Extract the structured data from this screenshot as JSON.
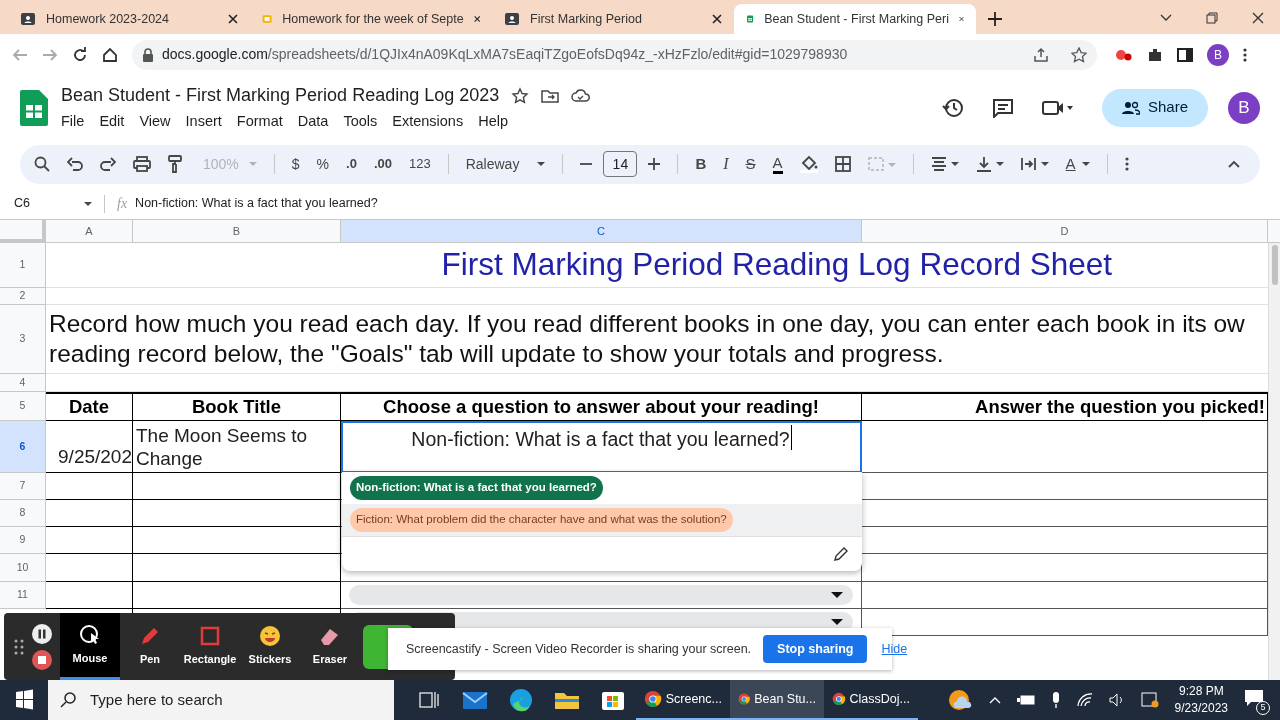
{
  "browser": {
    "tabs": [
      {
        "kind": "classroom",
        "title": "Homework 2023-2024",
        "selected": false
      },
      {
        "kind": "slides",
        "title": "Homework for the week of Septe",
        "selected": false
      },
      {
        "kind": "classroom",
        "title": "First Marking Period",
        "selected": false
      },
      {
        "kind": "sheets",
        "title": "Bean Student - First Marking Peri",
        "selected": true
      }
    ],
    "url_host": "docs.google.com",
    "url_path": "/spreadsheets/d/1QJIx4nA09KqLxMA7sEaqiTZgoEofsDq94z_-xHzFzlo/edit#gid=1029798930",
    "profile": "B"
  },
  "doc": {
    "title": "Bean Student - First Marking Period Reading Log 2023",
    "menu": [
      "File",
      "Edit",
      "View",
      "Insert",
      "Format",
      "Data",
      "Tools",
      "Extensions",
      "Help"
    ],
    "share": "Share",
    "avatar": "B"
  },
  "toolbar": {
    "zoom": "100%",
    "currency": "$",
    "percent": "%",
    "decrease_decimals": ".0",
    "increase_decimals": ".00",
    "number_format": "123",
    "font": "Raleway",
    "font_size": "14",
    "bold": "B",
    "italic": "I",
    "strikethrough": "S",
    "text_color": "A",
    "text_rotation": "A"
  },
  "formula_bar": {
    "cell": "C6",
    "fx_label": "fx",
    "formula": "Non-fiction: What is a fact that you learned?"
  },
  "sheet": {
    "columns": [
      {
        "label": "A",
        "selected": false
      },
      {
        "label": "B",
        "selected": false
      },
      {
        "label": "C",
        "selected": true
      },
      {
        "label": "D",
        "selected": false
      }
    ],
    "title": "First Marking Period Reading Log Record Sheet",
    "instructions": [
      "Record how much you read each day. If you read different books in one day, you can enter each book in its ow",
      "reading record below, the \"Goals\" tab will update to show your totals and progress."
    ],
    "headers": [
      "Date",
      "Book Title",
      "Choose a question to answer about your reading!",
      "Answer the question you picked!"
    ],
    "rows": [
      {
        "number": "1",
        "selected": false
      },
      {
        "number": "2",
        "selected": false
      },
      {
        "number": "3",
        "selected": false
      },
      {
        "number": "4",
        "selected": false
      },
      {
        "number": "5",
        "selected": false
      },
      {
        "number": "6",
        "selected": true,
        "date": "9/25/202",
        "book": "The Moon Seems to Change",
        "question": "Non-fiction: What is a fact that you learned?"
      },
      {
        "number": "7",
        "selected": false,
        "dropdown": false
      },
      {
        "number": "8",
        "selected": false,
        "dropdown": false
      },
      {
        "number": "9",
        "selected": false,
        "dropdown": false
      },
      {
        "number": "10",
        "selected": false,
        "dropdown": false
      },
      {
        "number": "11",
        "selected": false,
        "dropdown": true
      },
      {
        "dropdown": true
      }
    ]
  },
  "dropdown": {
    "options": [
      {
        "text": "Non-fiction: What is a fact that you learned?",
        "color": "#11734b",
        "hovered": false
      },
      {
        "text": "Fiction: What problem did the character have and what was the solution?",
        "color": "#ffc8aa",
        "hovered": true
      }
    ]
  },
  "screencastify": {
    "tools": [
      {
        "label": "Mouse",
        "selected": true
      },
      {
        "label": "Pen",
        "selected": false
      },
      {
        "label": "Rectangle",
        "selected": false
      },
      {
        "label": "Stickers",
        "selected": false
      },
      {
        "label": "Eraser",
        "selected": false
      }
    ],
    "notice": "Screencastify - Screen Video Recorder is sharing your screen.",
    "stop": "Stop sharing",
    "hide": "Hide"
  },
  "taskbar": {
    "search_placeholder": "Type here to search",
    "apps": [
      {
        "label": "Screenc...",
        "active": false
      },
      {
        "label": "Bean Stu...",
        "active": true
      },
      {
        "label": "ClassDoj...",
        "active": false
      }
    ],
    "time": "9:28 PM",
    "date": "9/23/2023",
    "notifications": "5"
  }
}
